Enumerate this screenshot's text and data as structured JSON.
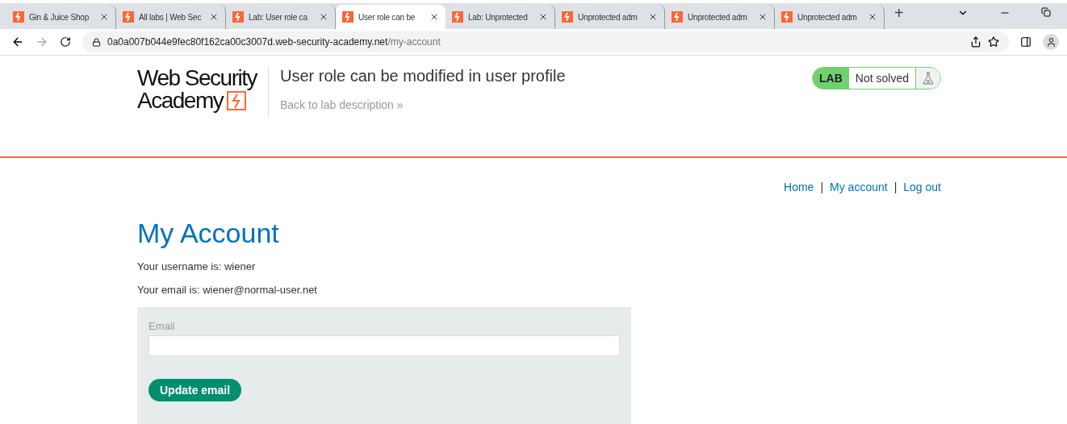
{
  "browser": {
    "tabs": [
      {
        "title": "Gin & Juice Shop",
        "selected": false
      },
      {
        "title": "All labs | Web Sec",
        "selected": false
      },
      {
        "title": "Lab: User role ca",
        "selected": false
      },
      {
        "title": "User role can be",
        "selected": true
      },
      {
        "title": "Lab: Unprotected",
        "selected": false
      },
      {
        "title": "Unprotected adm",
        "selected": false
      },
      {
        "title": "Unprotected adm",
        "selected": false
      },
      {
        "title": "Unprotected adm",
        "selected": false
      }
    ],
    "new_tab": "+",
    "url": {
      "host": "0a0a007b044e9fec80f162ca00c3007d.web-security-academy.net",
      "path": "/my-account"
    }
  },
  "header": {
    "logo": [
      "Web Security",
      "Academy"
    ],
    "title": "User role can be modified in user profile",
    "back_link": "Back to lab description",
    "back_arrow": "»",
    "lab_badge": {
      "label": "LAB",
      "status": "Not solved",
      "solved": false
    }
  },
  "nav": {
    "links": [
      "Home",
      "My account",
      "Log out"
    ],
    "separator": "|"
  },
  "page": {
    "heading": "My Account",
    "lines": [
      "Your username is: wiener",
      "Your email is: wiener@normal-user.net"
    ],
    "form": {
      "label": "Email",
      "button": "Update email"
    }
  }
}
